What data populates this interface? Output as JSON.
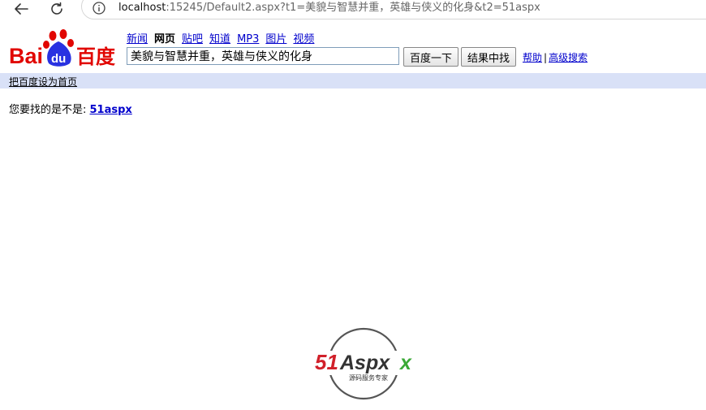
{
  "browser": {
    "url_host": "localhost",
    "url_rest": ":15245/Default2.aspx?t1=美貌与智慧并重，英雄与侠义的化身&t2=51aspx",
    "icons": [
      "back-arrow-icon",
      "reload-icon",
      "info-icon"
    ]
  },
  "logo": {
    "text_bai": "Bai",
    "text_du": "du",
    "text_chinese": "百度"
  },
  "nav": {
    "items": [
      {
        "label": "新闻",
        "active": false
      },
      {
        "label": "网页",
        "active": true
      },
      {
        "label": "贴吧",
        "active": false
      },
      {
        "label": "知道",
        "active": false
      },
      {
        "label": "MP3",
        "active": false
      },
      {
        "label": "图片",
        "active": false
      },
      {
        "label": "视频",
        "active": false
      }
    ]
  },
  "search": {
    "value": "美貌与智慧并重，英雄与侠义的化身",
    "search_button": "百度一下",
    "search_within_button": "结果中找"
  },
  "help": {
    "help_label": "帮助",
    "separator": "|",
    "advanced_label": "高级搜索"
  },
  "homepage_bar": {
    "label": "把百度设为首页",
    "color": "#d9e1f7"
  },
  "suggestion": {
    "prefix": "您要找的是不是: ",
    "link": "51aspx"
  },
  "watermark": {
    "brand_51": "51",
    "brand_aspx": "Aspx",
    "tagline": "源码服务专家"
  },
  "colors": {
    "link": "#0000cc",
    "logo_red": "#e10601",
    "logo_blue": "#2932e1"
  }
}
